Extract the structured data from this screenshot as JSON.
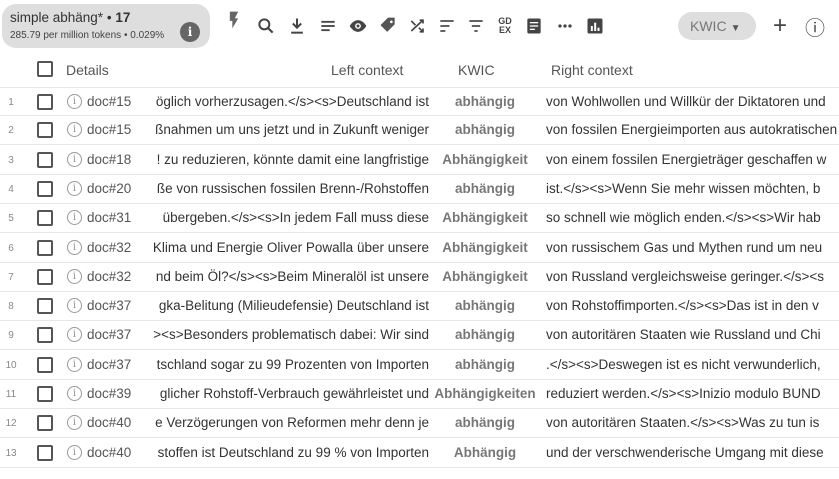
{
  "query": {
    "text": "simple abhäng*",
    "count_sep": "•",
    "count": "17",
    "stats": "285.79 per million tokens • 0.029%",
    "info_icon": "i"
  },
  "toolbar": {
    "icons": [
      "flash-icon",
      "search-icon",
      "download-icon",
      "list-icon",
      "eye-icon",
      "tag-icon",
      "shuffle-icon",
      "sort-icon",
      "filter-icon",
      "gdex-icon",
      "document-icon",
      "more-icon",
      "chart-icon"
    ],
    "gdex_label": "GD\nEX",
    "view_selector": {
      "value": "KWIC",
      "arrow": "▼"
    },
    "add_label": "+",
    "info_label": "ⓘ"
  },
  "table": {
    "headers": {
      "details": "Details",
      "left": "Left context",
      "kwic": "KWIC",
      "right": "Right context"
    },
    "rows": [
      {
        "n": "1",
        "doc": "doc#15",
        "left": "öglich vorherzusagen.</s><s>Deutschland ist",
        "kwic": "abhängig",
        "right": "von Wohlwollen und Willkür der Diktatoren und"
      },
      {
        "n": "2",
        "doc": "doc#15",
        "left": "ßnahmen um uns jetzt und in Zukunft weniger",
        "kwic": "abhängig",
        "right": "von fossilen Energieimporten aus autokratischen"
      },
      {
        "n": "3",
        "doc": "doc#18",
        "left": "! zu reduzieren, könnte damit eine langfristige",
        "kwic": "Abhängigkeit",
        "right": "von einem fossilen Energieträger geschaffen w"
      },
      {
        "n": "4",
        "doc": "doc#20",
        "left": "ße von russischen fossilen Brenn-/Rohstoffen",
        "kwic": "abhängig",
        "right": "ist.</s><s>Wenn Sie mehr wissen möchten, b"
      },
      {
        "n": "5",
        "doc": "doc#31",
        "left": "übergeben.</s><s>In jedem Fall muss diese",
        "kwic": "Abhängigkeit",
        "right": "so schnell wie möglich enden.</s><s>Wir hab"
      },
      {
        "n": "6",
        "doc": "doc#32",
        "left": "Klima und Energie Oliver Powalla über unsere",
        "kwic": "Abhängigkeit",
        "right": "von russischem Gas und Mythen rund um neu"
      },
      {
        "n": "7",
        "doc": "doc#32",
        "left": "nd beim Öl?</s><s>Beim Mineralöl ist unsere",
        "kwic": "Abhängigkeit",
        "right": "von Russland vergleichsweise geringer.</s><s"
      },
      {
        "n": "8",
        "doc": "doc#37",
        "left": "gka-Belitung (Milieudefensie) Deutschland ist",
        "kwic": "abhängig",
        "right": "von Rohstoffimporten.</s><s>Das ist in den v"
      },
      {
        "n": "9",
        "doc": "doc#37",
        "left": "><s>Besonders problematisch dabei: Wir sind",
        "kwic": "abhängig",
        "right": "von autoritären Staaten wie Russland und Chi"
      },
      {
        "n": "10",
        "doc": "doc#37",
        "left": "tschland sogar zu 99 Prozenten von Importen",
        "kwic": "abhängig",
        "right": ".</s><s>Deswegen ist es nicht verwunderlich,"
      },
      {
        "n": "11",
        "doc": "doc#39",
        "left": "glicher Rohstoff-Verbrauch gewährleistet und",
        "kwic": "Abhängigkeiten",
        "right": "reduziert werden.</s><s>Inizio modulo BUND"
      },
      {
        "n": "12",
        "doc": "doc#40",
        "left": "e Verzögerungen von Reformen mehr denn je",
        "kwic": "abhängig",
        "right": "von autoritären Staaten.</s><s>Was zu tun is"
      },
      {
        "n": "13",
        "doc": "doc#40",
        "left": "stoffen ist Deutschland zu 99 % von Importen",
        "kwic": "Abhängig",
        "right": "und der verschwenderische Umgang mit diese"
      }
    ]
  }
}
